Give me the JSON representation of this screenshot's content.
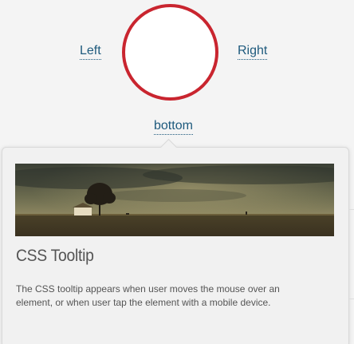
{
  "triggers": {
    "left": "Left",
    "right": "Right",
    "bottom": "bottom"
  },
  "tooltip": {
    "title": "CSS Tooltip",
    "description": "The CSS tooltip appears when user moves the mouse over an element, or when user tap the element with a mobile device."
  },
  "colors": {
    "circle_border": "#c9252f",
    "link": "#1e5a7d",
    "tooltip_bg": "#f1f1f1"
  }
}
